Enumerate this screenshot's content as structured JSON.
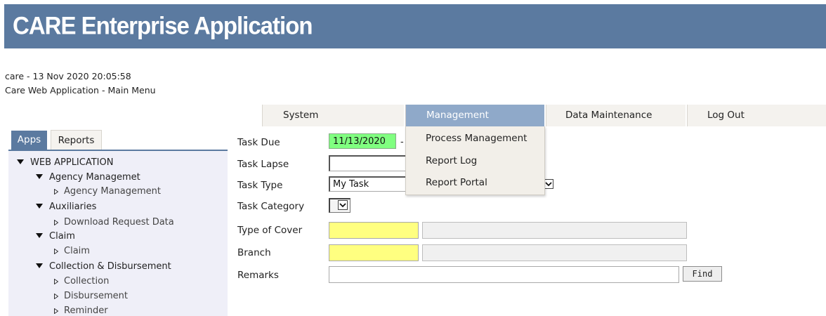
{
  "header": {
    "title": "CARE Enterprise Application"
  },
  "status": {
    "line1": "care - 13 Nov 2020 20:05:58",
    "line2": "Care Web Application - Main Menu"
  },
  "nav": {
    "system": "System",
    "management": "Management",
    "data_maintenance": "Data Maintenance",
    "logout": "Log Out",
    "management_menu": [
      "Process Management",
      "Report Log",
      "Report Portal"
    ]
  },
  "sidebar": {
    "tabs": [
      "Apps",
      "Reports"
    ],
    "tree": [
      {
        "level": 0,
        "label": "WEB APPLICATION"
      },
      {
        "level": 1,
        "label": "Agency Managemet"
      },
      {
        "level": 2,
        "label": "Agency Management"
      },
      {
        "level": 1,
        "label": "Auxiliaries"
      },
      {
        "level": 2,
        "label": "Download Request Data"
      },
      {
        "level": 1,
        "label": "Claim"
      },
      {
        "level": 2,
        "label": "Claim"
      },
      {
        "level": 1,
        "label": "Collection & Disbursement"
      },
      {
        "level": 2,
        "label": "Collection"
      },
      {
        "level": 2,
        "label": "Disbursement"
      },
      {
        "level": 2,
        "label": "Reminder"
      }
    ]
  },
  "form": {
    "task_due_label": "Task Due",
    "task_due_value": "11/13/2020",
    "task_due_sep": "-",
    "task_lapse_label": "Task Lapse",
    "task_lapse_value": "",
    "task_type_label": "Task Type",
    "task_type_value": "My Task",
    "task_category_label": "Task Category",
    "type_of_cover_label": "Type of Cover",
    "branch_label": "Branch",
    "remarks_label": "Remarks",
    "remarks_value": "",
    "find_label": "Find"
  },
  "colors": {
    "header_bg": "#5b7aa0",
    "nav_active": "#8fa9c9",
    "required_field": "#ffff80",
    "date_field": "#80ff80",
    "sidebar_bg": "#efeff8"
  }
}
